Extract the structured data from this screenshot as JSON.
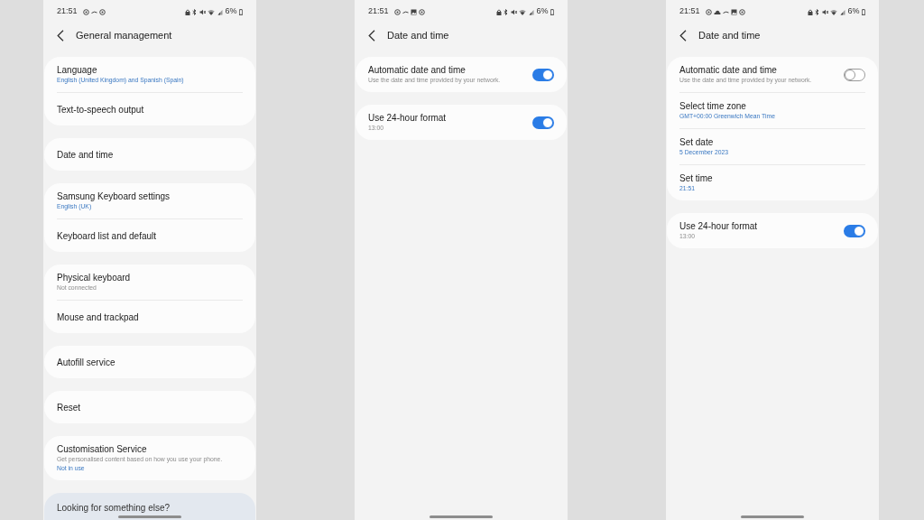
{
  "screens": [
    {
      "status_bar": {
        "time": "21:51",
        "notification_icons": [
          {
            "kind": "ring"
          },
          {
            "kind": "dash"
          },
          {
            "kind": "ring"
          }
        ],
        "battery": "6%"
      },
      "header": {
        "title": "General management"
      },
      "groups": [
        {
          "items": [
            {
              "title": "Language",
              "value": "English (United Kingdom) and Spanish (Spain)"
            },
            {
              "title": "Text-to-speech output"
            }
          ]
        },
        {
          "items": [
            {
              "title": "Date and time"
            }
          ]
        },
        {
          "items": [
            {
              "title": "Samsung Keyboard settings",
              "value": "English (UK)"
            },
            {
              "title": "Keyboard list and default"
            }
          ]
        },
        {
          "items": [
            {
              "title": "Physical keyboard",
              "summary": "Not connected"
            },
            {
              "title": "Mouse and trackpad"
            }
          ]
        },
        {
          "items": [
            {
              "title": "Autofill service"
            }
          ]
        },
        {
          "items": [
            {
              "title": "Reset"
            }
          ]
        },
        {
          "items": [
            {
              "title": "Customisation Service",
              "summary": "Get personalised content based on how you use your phone.",
              "value": "Not in use"
            }
          ]
        }
      ],
      "suggestion_card": {
        "title": "Looking for something else?"
      }
    },
    {
      "status_bar": {
        "time": "21:51",
        "notification_icons": [
          {
            "kind": "ring"
          },
          {
            "kind": "dash"
          },
          {
            "kind": "image"
          },
          {
            "kind": "ring"
          }
        ],
        "battery": "6%"
      },
      "header": {
        "title": "Date and time"
      },
      "groups": [
        {
          "items": [
            {
              "title": "Automatic date and time",
              "summary": "Use the date and time provided by your network.",
              "toggle": {
                "on": true
              }
            }
          ]
        },
        {
          "items": [
            {
              "title": "Use 24-hour format",
              "summary": "13:00",
              "toggle": {
                "on": true
              }
            }
          ]
        }
      ]
    },
    {
      "status_bar": {
        "time": "21:51",
        "notification_icons": [
          {
            "kind": "ring"
          },
          {
            "kind": "cloud"
          },
          {
            "kind": "dash"
          },
          {
            "kind": "image"
          },
          {
            "kind": "ring"
          }
        ],
        "battery": "6%"
      },
      "header": {
        "title": "Date and time"
      },
      "groups": [
        {
          "items": [
            {
              "title": "Automatic date and time",
              "summary": "Use the date and time provided by your network.",
              "toggle": {
                "on": false
              }
            },
            {
              "title": "Select time zone",
              "value": "GMT+00:00 Greenwich Mean Time"
            },
            {
              "title": "Set date",
              "value": "5 December 2023"
            },
            {
              "title": "Set time",
              "value": "21:51"
            }
          ]
        },
        {
          "items": [
            {
              "title": "Use 24-hour format",
              "summary": "13:00",
              "toggle": {
                "on": true
              }
            }
          ]
        }
      ]
    }
  ]
}
